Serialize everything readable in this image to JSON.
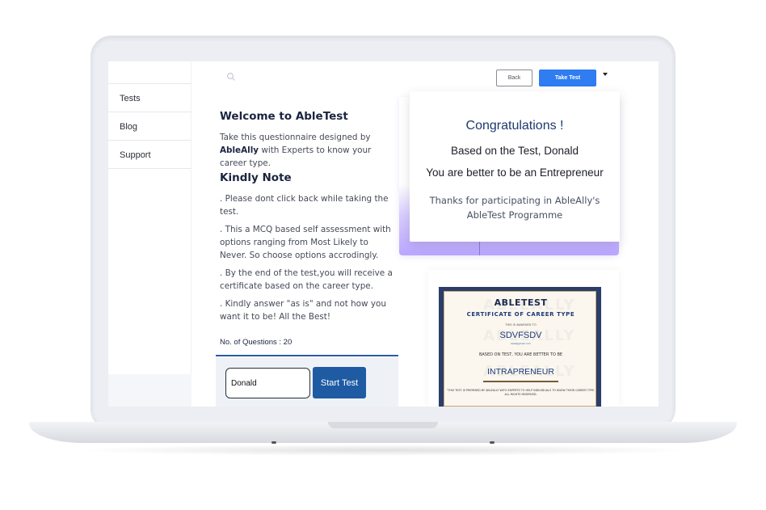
{
  "sidebar": {
    "items": [
      {
        "label": "Tests"
      },
      {
        "label": "Blog"
      },
      {
        "label": "Support"
      }
    ]
  },
  "toolbar": {
    "back_label": "Back",
    "take_test_label": "Take Test"
  },
  "intro": {
    "title": "Welcome to AbleTest",
    "desc_pre": "Take this questionnaire designed by ",
    "desc_brand": "AbleAlly",
    "desc_post": " with Experts to know your career type.",
    "note_title": "Kindly Note",
    "notes": [
      ". Please dont click back while taking the test.",
      ". This a MCQ based self assessment with options ranging from Most Likely to Never. So choose options accrodingly.",
      ". By the end of the test,you will receive a certificate based on the career type.",
      ". Kindly answer \"as is\" and not how you want it to be! All the Best!"
    ],
    "question_count": "No. of Questions : 20"
  },
  "form": {
    "name_value": "Donald",
    "start_label": "Start Test"
  },
  "result": {
    "title": "Congratulations !",
    "line1": "Based on the Test, Donald",
    "line2": "You are better to be an Entrepreneur",
    "thanks": "Thanks for participating in AbleAlly's AbleTest Programme"
  },
  "certificate": {
    "title": "ABLETEST",
    "subtitle": "CERTIFICATE OF CAREER TYPE",
    "awarded": "THIS IS AWARDED TO",
    "name": "SDVFSDV",
    "email": "test@gmail.com",
    "based": "BASED ON TEST, YOU ARE BETTER TO BE",
    "career": "INTRAPRENEUR",
    "footer": "\"THIS TEST IS PREPARED BY ABLEALLY WITH EXPERTS TO HELP INDIVIDUALS TO KNOW THEIR CAREER TYPE. ALL RIGHTS RESERVED.",
    "watermark": "ABLEALLY"
  }
}
